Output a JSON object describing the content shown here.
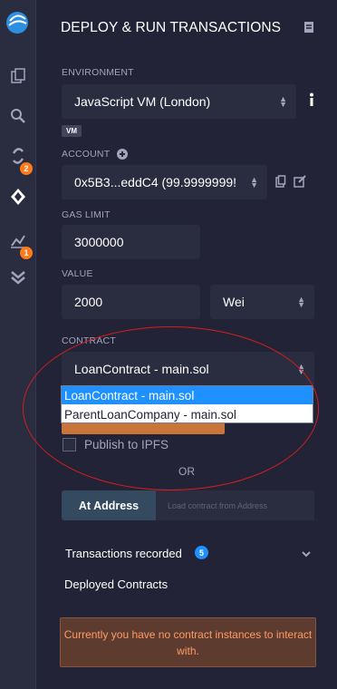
{
  "panel": {
    "title": "DEPLOY & RUN TRANSACTIONS"
  },
  "environment": {
    "label": "ENVIRONMENT",
    "value": "JavaScript VM (London)",
    "badge": "VM"
  },
  "account": {
    "label": "ACCOUNT",
    "value": "0x5B3...eddC4 (99.9999999!"
  },
  "gas_limit": {
    "label": "GAS LIMIT",
    "value": "3000000"
  },
  "value": {
    "label": "VALUE",
    "amount": "2000",
    "unit": "Wei"
  },
  "contract": {
    "label": "CONTRACT",
    "selected": "LoanContract - main.sol",
    "options": [
      "LoanContract - main.sol",
      "ParentLoanCompany - main.sol"
    ]
  },
  "publish": {
    "label": "Publish to IPFS"
  },
  "or_text": "OR",
  "at_address": {
    "button": "At Address",
    "placeholder": "Load contract from Address"
  },
  "transactions": {
    "label": "Transactions recorded",
    "count": "5"
  },
  "deployed": {
    "label": "Deployed Contracts",
    "empty_message": "Currently you have no contract instances to interact with."
  },
  "rail": {
    "badges": [
      "2",
      "1"
    ],
    "icons": [
      "remix-logo-icon",
      "file-explorer-icon",
      "search-icon",
      "compiler-icon",
      "deploy-run-icon",
      "analysis-icon",
      "verification-icon"
    ]
  },
  "colors": {
    "panel_bg": "#222336",
    "field_bg": "#2a2c3f",
    "accent_blue": "#1e90ff",
    "badge_orange": "#ff7a1a",
    "annotation_red": "#d11f1f"
  }
}
